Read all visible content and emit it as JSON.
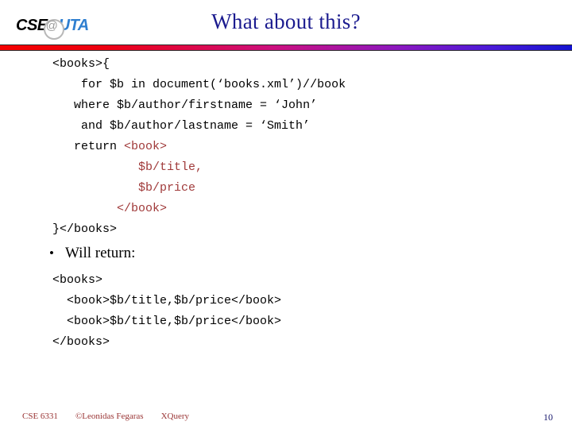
{
  "slide": {
    "title": "What about this?",
    "page_number": "10",
    "accent_navy": "#1b1b8f",
    "accent_red": "#a03a3a",
    "rule_gradient_from": "#f40000",
    "rule_gradient_to": "#1414d0"
  },
  "logo": {
    "part1": "CSE",
    "at_symbol": "@",
    "part2": "UTA",
    "part1_color": "#000000",
    "at_color": "#9a9a9a",
    "part2_color": "#2f7fd0"
  },
  "query_block": {
    "lines": [
      {
        "indent": 0,
        "segments": [
          {
            "text": "<books>{",
            "style": "plain"
          }
        ]
      },
      {
        "indent": 4,
        "segments": [
          {
            "text": "for $b in document(‘books.xml’)//book",
            "style": "plain"
          }
        ]
      },
      {
        "indent": 3,
        "segments": [
          {
            "text": "where $b/author/firstname = ‘John’",
            "style": "plain"
          }
        ]
      },
      {
        "indent": 4,
        "segments": [
          {
            "text": "and $b/author/lastname = ‘Smith’",
            "style": "plain"
          }
        ]
      },
      {
        "indent": 3,
        "segments": [
          {
            "text": "return ",
            "style": "plain"
          },
          {
            "text": "<book>",
            "style": "tag"
          }
        ]
      },
      {
        "indent": 12,
        "segments": [
          {
            "text": "$b/title,",
            "style": "tag"
          }
        ]
      },
      {
        "indent": 12,
        "segments": [
          {
            "text": "$b/price",
            "style": "tag"
          }
        ]
      },
      {
        "indent": 9,
        "segments": [
          {
            "text": "</book>",
            "style": "tag"
          }
        ]
      },
      {
        "indent": 0,
        "segments": [
          {
            "text": "}</books>",
            "style": "plain"
          }
        ]
      }
    ]
  },
  "will_return": {
    "bullet_glyph": "•",
    "label": "Will return:"
  },
  "result_block": {
    "lines": [
      {
        "indent": 0,
        "segments": [
          {
            "text": "<books>",
            "style": "plain"
          }
        ]
      },
      {
        "indent": 2,
        "segments": [
          {
            "text": "<book>$b/title,$b/price</book>",
            "style": "plain"
          }
        ]
      },
      {
        "indent": 2,
        "segments": [
          {
            "text": "<book>$b/title,$b/price</book>",
            "style": "plain"
          }
        ]
      },
      {
        "indent": 0,
        "segments": [
          {
            "text": "</books>",
            "style": "plain"
          }
        ]
      }
    ]
  },
  "footer": {
    "course": "CSE 6331",
    "author": "©Leonidas Fegaras",
    "topic": "XQuery",
    "color": "#993333"
  }
}
